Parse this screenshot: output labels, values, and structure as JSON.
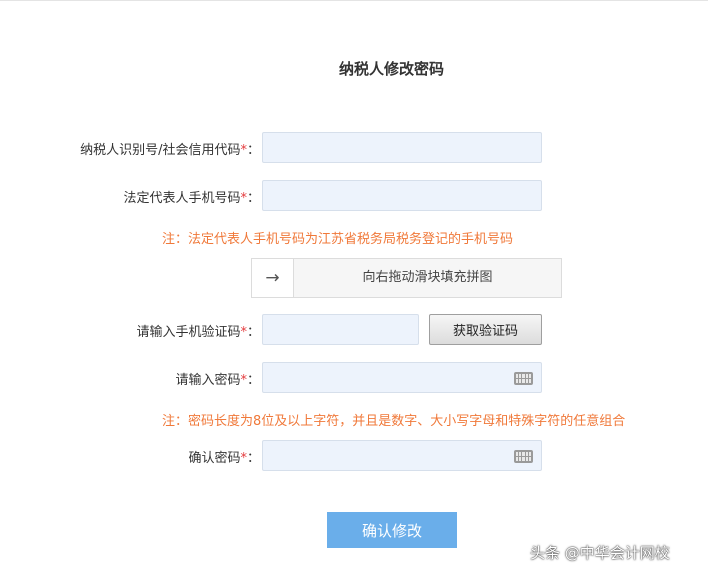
{
  "page": {
    "title": "纳税人修改密码"
  },
  "form": {
    "required_mark": "*",
    "colon": "：",
    "taxpayer_id": {
      "label": "纳税人识别号/社会信用代码",
      "value": ""
    },
    "legal_phone": {
      "label": "法定代表人手机号码",
      "value": ""
    },
    "phone_note": "注：法定代表人手机号码为江苏省税务局税务登记的手机号码",
    "slider": {
      "handle_icon": "arrow-right-icon",
      "handle_glyph": "→",
      "text": "向右拖动滑块填充拼图"
    },
    "sms_code": {
      "label": "请输入手机验证码",
      "value": ""
    },
    "get_code_button": "获取验证码",
    "password": {
      "label": "请输入密码",
      "value": "",
      "keyboard_icon": "keyboard-icon"
    },
    "password_note": "注：密码长度为8位及以上字符，并且是数字、大小写字母和特殊字符的任意组合",
    "confirm_password": {
      "label": "确认密码",
      "value": "",
      "keyboard_icon": "keyboard-icon"
    },
    "submit_button": "确认修改"
  },
  "colors": {
    "accent": "#6aaeea",
    "note": "#f0793a",
    "required": "#e4393c",
    "field_bg": "#edf3fc"
  },
  "watermark": "头条 @中华会计网校"
}
